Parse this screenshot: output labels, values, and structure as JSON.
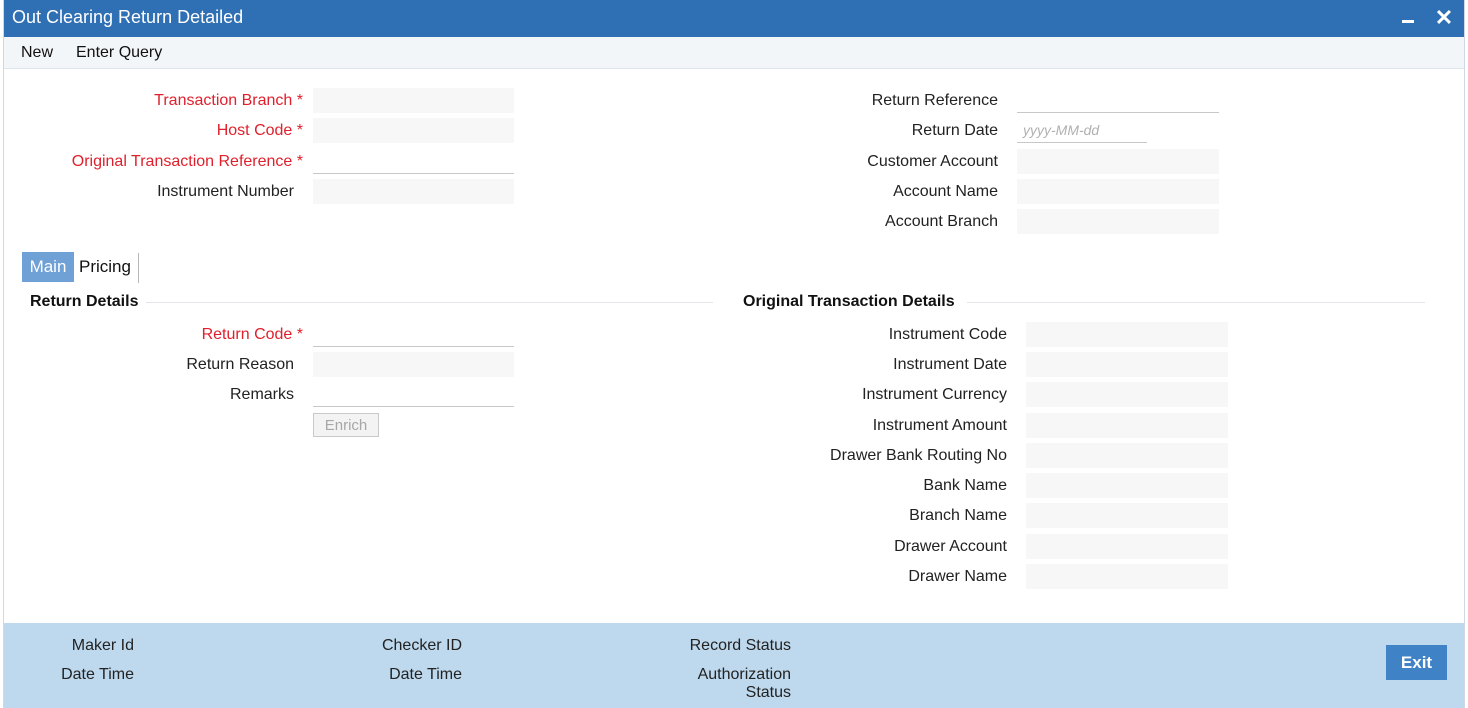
{
  "window": {
    "title": "Out Clearing Return Detailed"
  },
  "menu": {
    "new": "New",
    "enter_query": "Enter Query"
  },
  "header_left": {
    "transaction_branch": "Transaction Branch",
    "host_code": "Host Code",
    "original_transaction_reference": "Original Transaction Reference",
    "instrument_number": "Instrument Number",
    "required_mark": "*"
  },
  "header_right": {
    "return_reference": "Return Reference",
    "return_date": "Return Date",
    "return_date_placeholder": "yyyy-MM-dd",
    "customer_account": "Customer Account",
    "account_name": "Account Name",
    "account_branch": "Account Branch"
  },
  "tabs": [
    {
      "label": "Main",
      "active": true
    },
    {
      "label": "Pricing",
      "active": false
    }
  ],
  "return_details": {
    "title": "Return Details",
    "return_code": "Return Code",
    "return_reason": "Return Reason",
    "remarks": "Remarks",
    "enrich_button": "Enrich"
  },
  "original_transaction_details": {
    "title": "Original Transaction Details",
    "instrument_code": "Instrument Code",
    "instrument_date": "Instrument Date",
    "instrument_currency": "Instrument Currency",
    "instrument_amount": "Instrument Amount",
    "drawer_bank_routing_no": "Drawer Bank Routing No",
    "bank_name": "Bank Name",
    "branch_name": "Branch Name",
    "drawer_account": "Drawer Account",
    "drawer_name": "Drawer Name"
  },
  "footer": {
    "maker_id": "Maker Id",
    "maker_date_time": "Date Time",
    "checker_id": "Checker ID",
    "checker_date_time": "Date Time",
    "record_status": "Record Status",
    "authorization_status_line1": "Authorization",
    "authorization_status_line2": "Status",
    "exit_button": "Exit"
  },
  "colors": {
    "titlebar": "#2f6fb4",
    "required": "#e0202c",
    "footer": "#bed9ee",
    "exit": "#3f82c5",
    "active_tab": "#6fa0d6"
  }
}
